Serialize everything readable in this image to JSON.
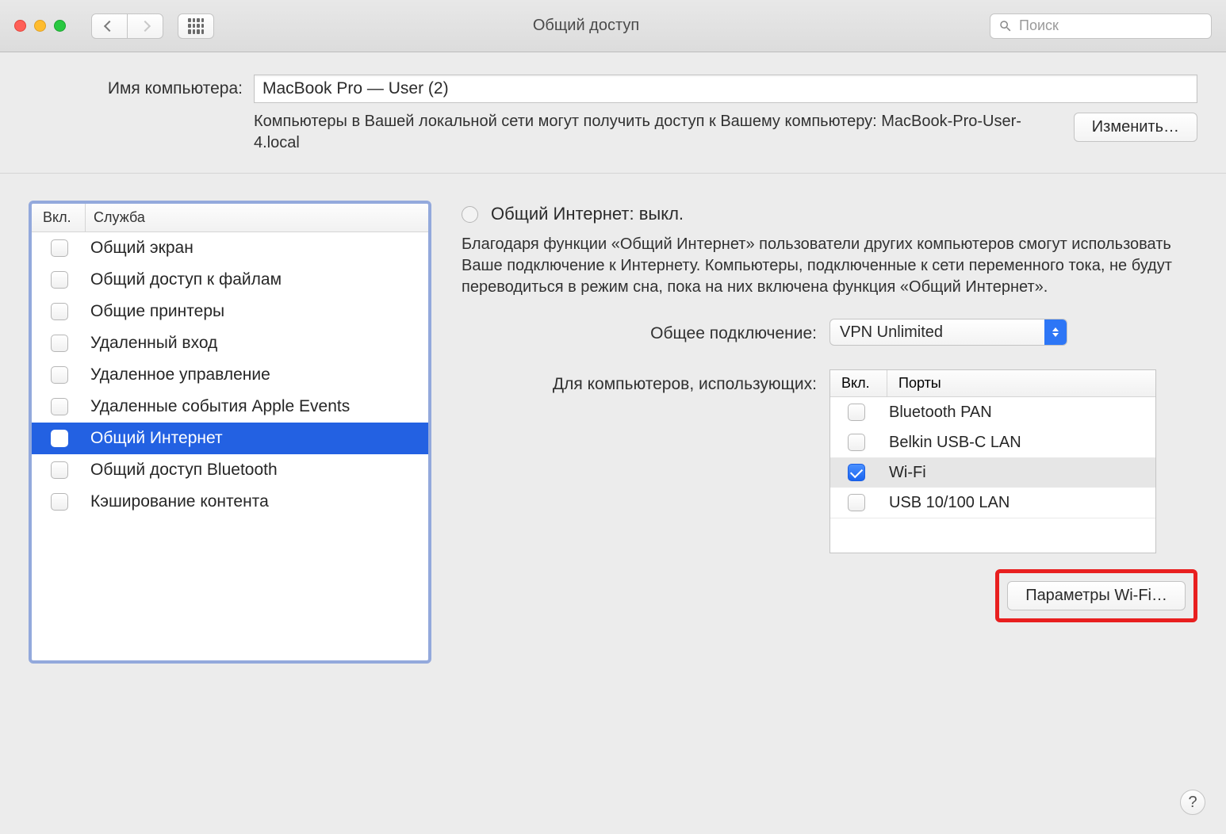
{
  "toolbar": {
    "title": "Общий доступ",
    "search_placeholder": "Поиск"
  },
  "computer_name": {
    "label": "Имя компьютера:",
    "value": "MacBook Pro — User (2)",
    "description": "Компьютеры в Вашей локальной сети могут получить доступ к Вашему компьютеру: MacBook-Pro-User-4.local",
    "edit_button": "Изменить…"
  },
  "services": {
    "header_on": "Вкл.",
    "header_service": "Служба",
    "items": [
      {
        "label": "Общий экран",
        "checked": false,
        "selected": false
      },
      {
        "label": "Общий доступ к файлам",
        "checked": false,
        "selected": false
      },
      {
        "label": "Общие принтеры",
        "checked": false,
        "selected": false
      },
      {
        "label": "Удаленный вход",
        "checked": false,
        "selected": false
      },
      {
        "label": "Удаленное управление",
        "checked": false,
        "selected": false
      },
      {
        "label": "Удаленные события Apple Events",
        "checked": false,
        "selected": false
      },
      {
        "label": "Общий Интернет",
        "checked": false,
        "selected": true
      },
      {
        "label": "Общий доступ Bluetooth",
        "checked": false,
        "selected": false
      },
      {
        "label": "Кэширование контента",
        "checked": false,
        "selected": false
      }
    ]
  },
  "detail": {
    "status": "Общий Интернет: выкл.",
    "description": "Благодаря функции «Общий Интернет» пользователи других компьютеров смогут использовать Ваше подключение к Интернету. Компьютеры, подключенные к сети переменного тока, не будут переводиться в режим сна, пока на них включена функция «Общий Интернет».",
    "share_from_label": "Общее подключение:",
    "share_from_value": "VPN Unlimited",
    "to_computers_label": "Для компьютеров, использующих:",
    "ports_header_on": "Вкл.",
    "ports_header_ports": "Порты",
    "ports": [
      {
        "label": "Bluetooth PAN",
        "checked": false,
        "selected": false
      },
      {
        "label": "Belkin USB-C LAN",
        "checked": false,
        "selected": false
      },
      {
        "label": "Wi-Fi",
        "checked": true,
        "selected": true
      },
      {
        "label": "USB 10/100 LAN",
        "checked": false,
        "selected": false
      }
    ],
    "wifi_options_button": "Параметры Wi-Fi…"
  },
  "help_label": "?"
}
